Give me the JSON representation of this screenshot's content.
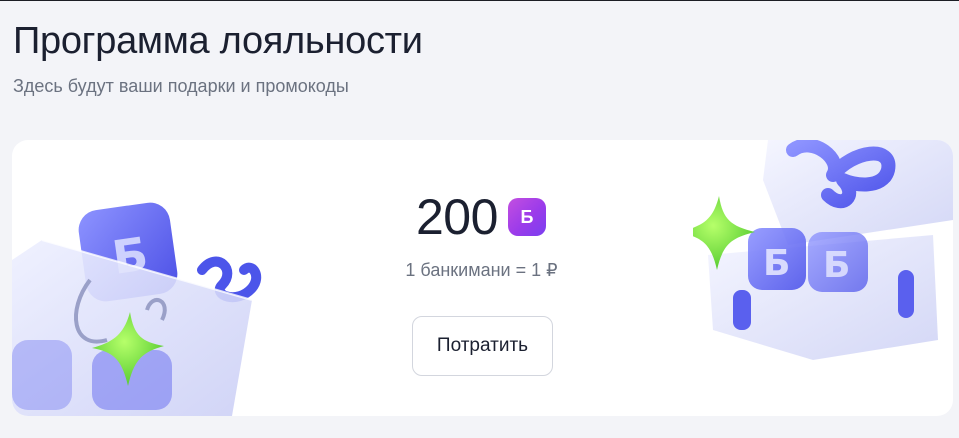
{
  "header": {
    "title": "Программа лояльности",
    "subtitle": "Здесь будут ваши подарки и промокоды"
  },
  "loyalty_card": {
    "balance": "200",
    "bonus_badge": "Б",
    "rate": "1 банкимани = 1 ₽",
    "spend_button_label": "Потратить"
  },
  "colors": {
    "page_background": "#f3f4f8",
    "card_background": "#ffffff",
    "badge_gradient_start": "#c34fe0",
    "badge_gradient_end": "#7a3ff0",
    "star_green": "#7be03a",
    "icon_blue": "#5b63f0"
  },
  "icons": {
    "left_illustration": "shopping-bag-with-star-illustration",
    "right_illustration": "gift-box-with-star-illustration"
  }
}
